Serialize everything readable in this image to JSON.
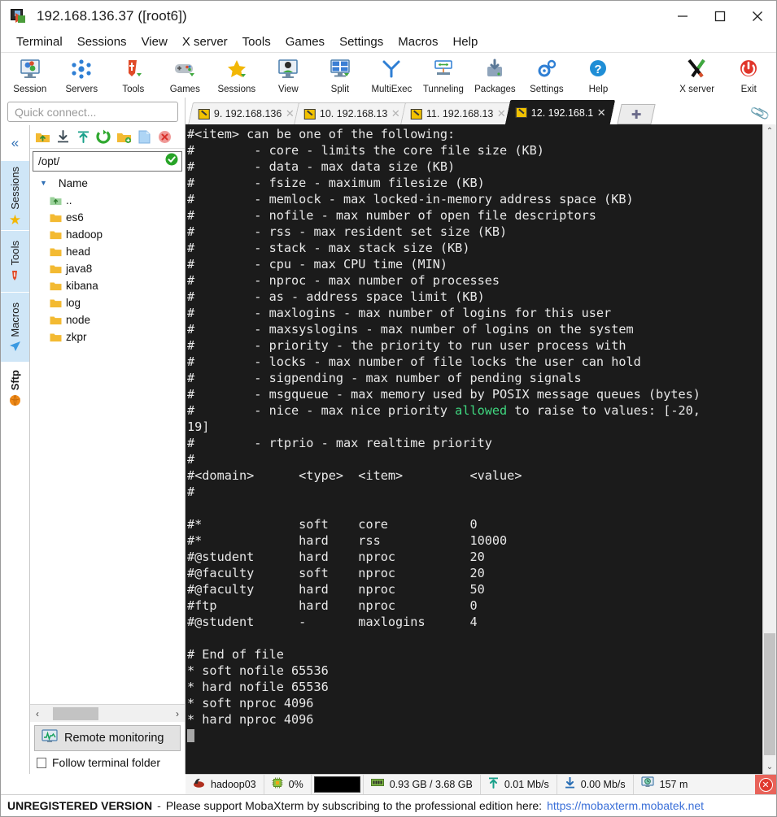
{
  "window": {
    "title": "192.168.136.37 ([root6])",
    "icon": "mobaxterm-icon",
    "minimize": "—",
    "maximize": "□",
    "close": "✕"
  },
  "menu": {
    "items": [
      {
        "label": "Terminal"
      },
      {
        "label": "Sessions"
      },
      {
        "label": "View"
      },
      {
        "label": "X server"
      },
      {
        "label": "Tools"
      },
      {
        "label": "Games"
      },
      {
        "label": "Settings"
      },
      {
        "label": "Macros"
      },
      {
        "label": "Help"
      }
    ]
  },
  "toolbar": {
    "buttons": [
      {
        "label": "Session",
        "icon": "session-icon"
      },
      {
        "label": "Servers",
        "icon": "servers-icon"
      },
      {
        "label": "Tools",
        "icon": "tools-icon"
      },
      {
        "label": "Games",
        "icon": "games-icon"
      },
      {
        "label": "Sessions",
        "icon": "sessions-star-icon"
      },
      {
        "label": "View",
        "icon": "view-icon"
      },
      {
        "label": "Split",
        "icon": "split-icon"
      },
      {
        "label": "MultiExec",
        "icon": "multiexec-icon"
      },
      {
        "label": "Tunneling",
        "icon": "tunneling-icon"
      },
      {
        "label": "Packages",
        "icon": "packages-icon"
      },
      {
        "label": "Settings",
        "icon": "settings-gear-icon"
      },
      {
        "label": "Help",
        "icon": "help-icon"
      },
      {
        "label": "X server",
        "icon": "xserver-icon"
      },
      {
        "label": "Exit",
        "icon": "exit-power-icon"
      }
    ]
  },
  "sidebar": {
    "quick_connect_placeholder": "Quick connect...",
    "collapse_glyph": "«",
    "vtabs": [
      {
        "label": "Sessions",
        "icon": "star-icon",
        "glyph": "★",
        "color": "#f2b705",
        "active": false
      },
      {
        "label": "Tools",
        "icon": "knife-icon",
        "glyph": "🔪",
        "color": "#d94f2b",
        "active": false
      },
      {
        "label": "Macros",
        "icon": "paper-plane-icon",
        "glyph": "➤",
        "color": "#3b9ae1",
        "active": false
      },
      {
        "label": "Sftp",
        "icon": "globe-icon",
        "glyph": "●",
        "color": "#f08a18",
        "active": true
      }
    ],
    "browser_toolbar": [
      {
        "icon": "parent-folder-icon"
      },
      {
        "icon": "download-icon"
      },
      {
        "icon": "upload-icon"
      },
      {
        "icon": "refresh-icon"
      },
      {
        "icon": "new-folder-icon"
      },
      {
        "icon": "new-file-icon"
      },
      {
        "icon": "delete-icon"
      }
    ],
    "path": "/opt/",
    "path_ok_icon": "check-circle-icon",
    "column_header": "Name",
    "files": [
      {
        "name": "..",
        "type": "parent"
      },
      {
        "name": "es6",
        "type": "folder"
      },
      {
        "name": "hadoop",
        "type": "folder"
      },
      {
        "name": "head",
        "type": "folder"
      },
      {
        "name": "java8",
        "type": "folder"
      },
      {
        "name": "kibana",
        "type": "folder"
      },
      {
        "name": "log",
        "type": "folder"
      },
      {
        "name": "node",
        "type": "folder"
      },
      {
        "name": "zkpr",
        "type": "folder"
      }
    ],
    "remote_monitoring": "Remote monitoring",
    "follow_terminal_folder": "Follow terminal folder",
    "scroll_left": "‹",
    "scroll_right": "›"
  },
  "tabs": {
    "items": [
      {
        "label": "9. 192.168.136",
        "active": false,
        "close": "✕"
      },
      {
        "label": "10. 192.168.13",
        "active": false,
        "close": "✕"
      },
      {
        "label": "11. 192.168.13",
        "active": false,
        "close": "✕"
      },
      {
        "label": "12. 192.168.1",
        "active": true,
        "close": "✕"
      }
    ],
    "new_tab_glyph": "✚",
    "clip_icon": "paperclip-icon"
  },
  "terminal": {
    "lines": [
      [
        {
          "t": "#<item> can be one of the following:"
        }
      ],
      [
        {
          "t": "#        - core - limits the core file size (KB)"
        }
      ],
      [
        {
          "t": "#        - data - max data size (KB)"
        }
      ],
      [
        {
          "t": "#        - fsize - maximum filesize (KB)"
        }
      ],
      [
        {
          "t": "#        - memlock - max locked-in-memory address space (KB)"
        }
      ],
      [
        {
          "t": "#        - nofile - max number of open file descriptors"
        }
      ],
      [
        {
          "t": "#        - rss - max resident set size (KB)"
        }
      ],
      [
        {
          "t": "#        - stack - max stack size (KB)"
        }
      ],
      [
        {
          "t": "#        - cpu - max CPU time (MIN)"
        }
      ],
      [
        {
          "t": "#        - nproc - max number of processes"
        }
      ],
      [
        {
          "t": "#        - as - address space limit (KB)"
        }
      ],
      [
        {
          "t": "#        - maxlogins - max number of logins for this user"
        }
      ],
      [
        {
          "t": "#        - maxsyslogins - max number of logins on the system"
        }
      ],
      [
        {
          "t": "#        - priority - the priority to run user process with"
        }
      ],
      [
        {
          "t": "#        - locks - max number of file locks the user can hold"
        }
      ],
      [
        {
          "t": "#        - sigpending - max number of pending signals"
        }
      ],
      [
        {
          "t": "#        - msgqueue - max memory used by POSIX message queues (bytes)"
        }
      ],
      [
        {
          "t": "#        - nice - max nice priority "
        },
        {
          "t": "allowed",
          "c": "green"
        },
        {
          "t": " to raise to values: [-20,"
        }
      ],
      [
        {
          "t": "19]"
        }
      ],
      [
        {
          "t": "#        - rtprio - max realtime priority"
        }
      ],
      [
        {
          "t": "#"
        }
      ],
      [
        {
          "t": "#<domain>      <type>  <item>         <value>"
        }
      ],
      [
        {
          "t": "#"
        }
      ],
      [
        {
          "t": ""
        }
      ],
      [
        {
          "t": "#*             soft    core           0"
        }
      ],
      [
        {
          "t": "#*             hard    rss            10000"
        }
      ],
      [
        {
          "t": "#@student      hard    nproc          20"
        }
      ],
      [
        {
          "t": "#@faculty      soft    nproc          20"
        }
      ],
      [
        {
          "t": "#@faculty      hard    nproc          50"
        }
      ],
      [
        {
          "t": "#ftp           hard    nproc          0"
        }
      ],
      [
        {
          "t": "#@student      -       maxlogins      4"
        }
      ],
      [
        {
          "t": ""
        }
      ],
      [
        {
          "t": "# End of file"
        }
      ],
      [
        {
          "t": "* soft nofile 65536"
        }
      ],
      [
        {
          "t": "* hard nofile 65536"
        }
      ],
      [
        {
          "t": "* soft nproc 4096"
        }
      ],
      [
        {
          "t": "* hard nproc 4096"
        }
      ]
    ],
    "cursor": true,
    "bg_color": "#1b1b1b",
    "fg_color": "#e8e8e8",
    "accent_green": "#3fd77f",
    "scroll_up": "⌃",
    "scroll_down": "⌄"
  },
  "statusbar": {
    "cells": [
      {
        "icon": "linux-hat-icon",
        "label": "hadoop03"
      },
      {
        "icon": "cpu-icon",
        "label": "0%"
      },
      {
        "icon": "graph-icon",
        "label": ""
      },
      {
        "icon": "ram-icon",
        "label": "0.93 GB / 3.68 GB"
      },
      {
        "icon": "upload-arrow-icon",
        "label": "0.01 Mb/s"
      },
      {
        "icon": "download-arrow-icon",
        "label": "0.00 Mb/s"
      },
      {
        "icon": "latency-icon",
        "label": "157 m"
      }
    ],
    "close_glyph": "✕"
  },
  "footer": {
    "unregistered": "UNREGISTERED VERSION",
    "dash": "-",
    "support_text": "Please support MobaXterm by subscribing to the professional edition here:",
    "link": "https://mobaxterm.mobatek.net"
  }
}
